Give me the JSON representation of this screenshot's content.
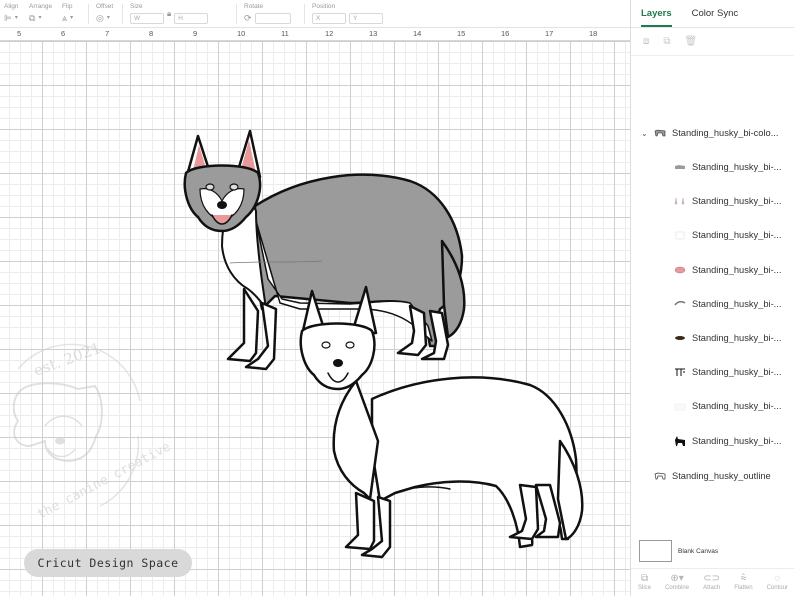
{
  "toolbar": {
    "align": {
      "label": "Align"
    },
    "arrange": {
      "label": "Arrange"
    },
    "flip": {
      "label": "Flip"
    },
    "offset": {
      "label": "Offset"
    },
    "size": {
      "label": "Size",
      "w": "W",
      "h": "H"
    },
    "rotate": {
      "label": "Rotate"
    },
    "position": {
      "label": "Position",
      "x": "X",
      "y": "Y"
    }
  },
  "ruler": {
    "numbers": [
      "5",
      "6",
      "7",
      "8",
      "9",
      "10",
      "11",
      "12",
      "13",
      "14",
      "15",
      "16",
      "17",
      "18"
    ]
  },
  "watermark": {
    "est": "est. 2021",
    "brand": "the canine creative"
  },
  "badge": {
    "label": "Cricut Design Space"
  },
  "panel": {
    "tabs": [
      {
        "label": "Layers",
        "active": true
      },
      {
        "label": "Color Sync",
        "active": false
      }
    ],
    "group": {
      "name": "Standing_husky_bi-colo..."
    },
    "layers": [
      {
        "name": "Standing_husky_bi-...",
        "icon": "gray-body-thumb"
      },
      {
        "name": "Standing_husky_bi-...",
        "icon": "ears-thumb"
      },
      {
        "name": "Standing_husky_bi-...",
        "icon": "white-thumb"
      },
      {
        "name": "Standing_husky_bi-...",
        "icon": "pink-tongue-thumb"
      },
      {
        "name": "Standing_husky_bi-...",
        "icon": "gray-eyes-thumb"
      },
      {
        "name": "Standing_husky_bi-...",
        "icon": "dark-nose-thumb"
      },
      {
        "name": "Standing_husky_bi-...",
        "icon": "black-detail-thumb"
      },
      {
        "name": "Standing_husky_bi-...",
        "icon": "faint-thumb"
      },
      {
        "name": "Standing_husky_bi-...",
        "icon": "black-silhouette-thumb"
      }
    ],
    "outline": {
      "name": "Standing_husky_outline"
    },
    "blank_canvas": {
      "label": "Blank Canvas"
    },
    "tools": [
      {
        "label": "Slice",
        "icon": "slice-icon"
      },
      {
        "label": "Combine",
        "icon": "combine-icon"
      },
      {
        "label": "Attach",
        "icon": "attach-icon"
      },
      {
        "label": "Flatten",
        "icon": "flatten-icon"
      },
      {
        "label": "Contour",
        "icon": "contour-icon"
      }
    ]
  },
  "colors": {
    "accent": "#1f7a4d",
    "husky_gray": "#9b9b9b",
    "tongue": "#e8999a",
    "grid_major": "#cfcfcf",
    "grid_minor": "#ececec"
  }
}
